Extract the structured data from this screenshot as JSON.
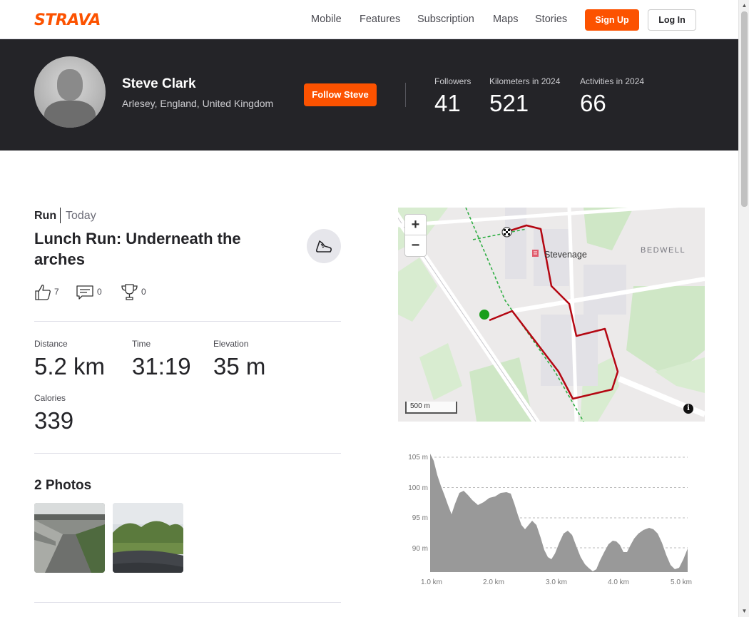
{
  "nav": {
    "logo": "STRAVA",
    "links": [
      "Mobile",
      "Features",
      "Subscription",
      "Maps",
      "Stories"
    ],
    "signup": "Sign Up",
    "login": "Log In"
  },
  "athlete": {
    "name": "Steve Clark",
    "location": "Arlesey, England, United Kingdom",
    "follow": "Follow Steve",
    "stats": [
      {
        "label": "Followers",
        "value": "41"
      },
      {
        "label": "Kilometers in 2024",
        "value": "521"
      },
      {
        "label": "Activities in 2024",
        "value": "66"
      }
    ]
  },
  "activity": {
    "type": "Run",
    "date": "Today",
    "title": "Lunch Run: Underneath the arches",
    "kudos": "7",
    "comments": "0",
    "achievements": "0",
    "metrics": [
      {
        "label": "Distance",
        "value": "5.2 km"
      },
      {
        "label": "Time",
        "value": "31:19"
      },
      {
        "label": "Elevation",
        "value": "35 m"
      },
      {
        "label": "Calories",
        "value": "339"
      }
    ],
    "photos_title": "2 Photos"
  },
  "map": {
    "zoom_in": "+",
    "zoom_out": "−",
    "town": "Stevenage",
    "area": "BEDWELL",
    "scale": "500 m",
    "info": "i"
  },
  "elevation_chart": {
    "y_ticks": [
      "105 m",
      "100 m",
      "95 m",
      "90 m"
    ],
    "x_ticks": [
      "1.0 km",
      "2.0 km",
      "3.0 km",
      "4.0 km",
      "5.0 km"
    ]
  },
  "colors": {
    "brand": "#fc5200",
    "header_bg": "#242428",
    "route": "#c1121f",
    "start_marker": "#1a9e1a"
  }
}
